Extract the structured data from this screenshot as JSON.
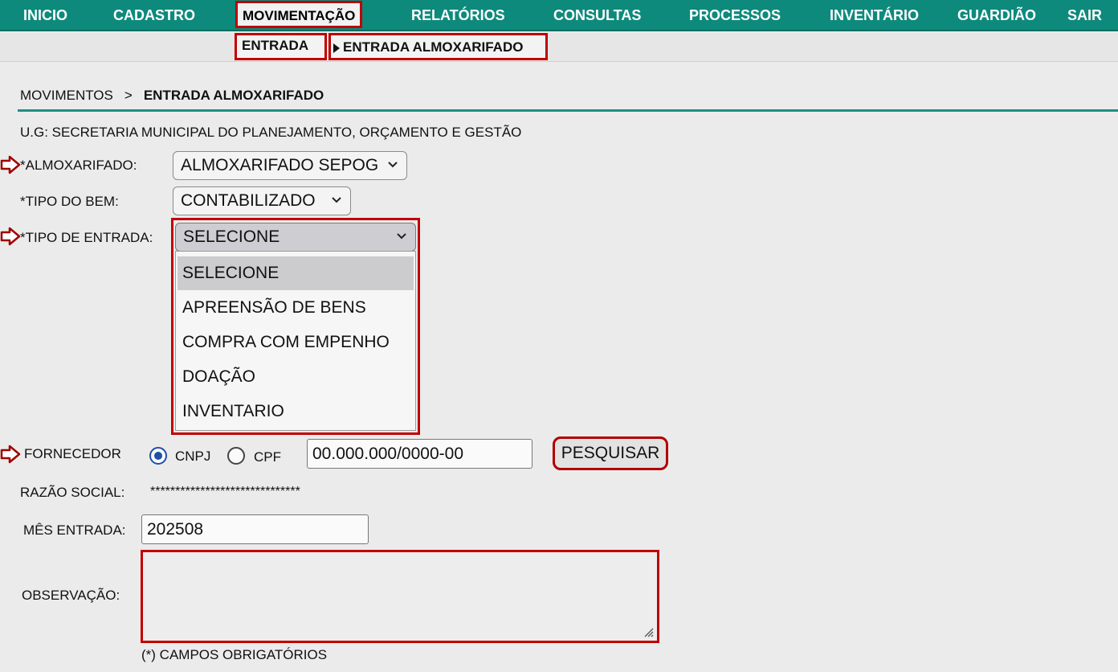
{
  "nav": {
    "items": [
      "INICIO",
      "CADASTRO",
      "MOVIMENTAÇÃO",
      "RELATÓRIOS",
      "CONSULTAS",
      "PROCESSOS",
      "INVENTÁRIO",
      "GUARDIÃO",
      "SAIR"
    ]
  },
  "submenu": {
    "entrada": "ENTRADA",
    "entrada_almox": "ENTRADA ALMOXARIFADO"
  },
  "breadcrumb": {
    "root": "MOVIMENTOS",
    "sep": ">",
    "current": "ENTRADA ALMOXARIFADO"
  },
  "form": {
    "ug": "U.G: SECRETARIA MUNICIPAL DO PLANEJAMENTO, ORÇAMENTO E GESTÃO",
    "almox_label": "*ALMOXARIFADO:",
    "almox_value": "ALMOXARIFADO SEPOG",
    "tipo_bem_label": "*TIPO DO BEM:",
    "tipo_bem_value": "CONTABILIZADO",
    "tipo_entrada_label": "*TIPO DE ENTRADA:",
    "tipo_entrada_value": "SELECIONE",
    "tipo_entrada_options": [
      "SELECIONE",
      "APREENSÃO DE BENS",
      "COMPRA COM EMPENHO",
      "DOAÇÃO",
      "INVENTARIO"
    ],
    "fornecedor_label": "FORNECEDOR",
    "cnpj_label": "CNPJ",
    "cpf_label": "CPF",
    "doc_value": "00.000.000/0000-00",
    "pesquisar": "PESQUISAR",
    "razao_label": "RAZÃO SOCIAL:",
    "razao_value": "******************************",
    "mes_label": "MÊS ENTRADA:",
    "mes_value": "202508",
    "obs_label": "OBSERVAÇÃO:",
    "obs_value": "",
    "required_note": "(*) CAMPOS OBRIGATÓRIOS"
  },
  "colors": {
    "nav_bg": "#0d8a7c",
    "highlight": "#c00000",
    "radio_on": "#1f4fa8"
  }
}
